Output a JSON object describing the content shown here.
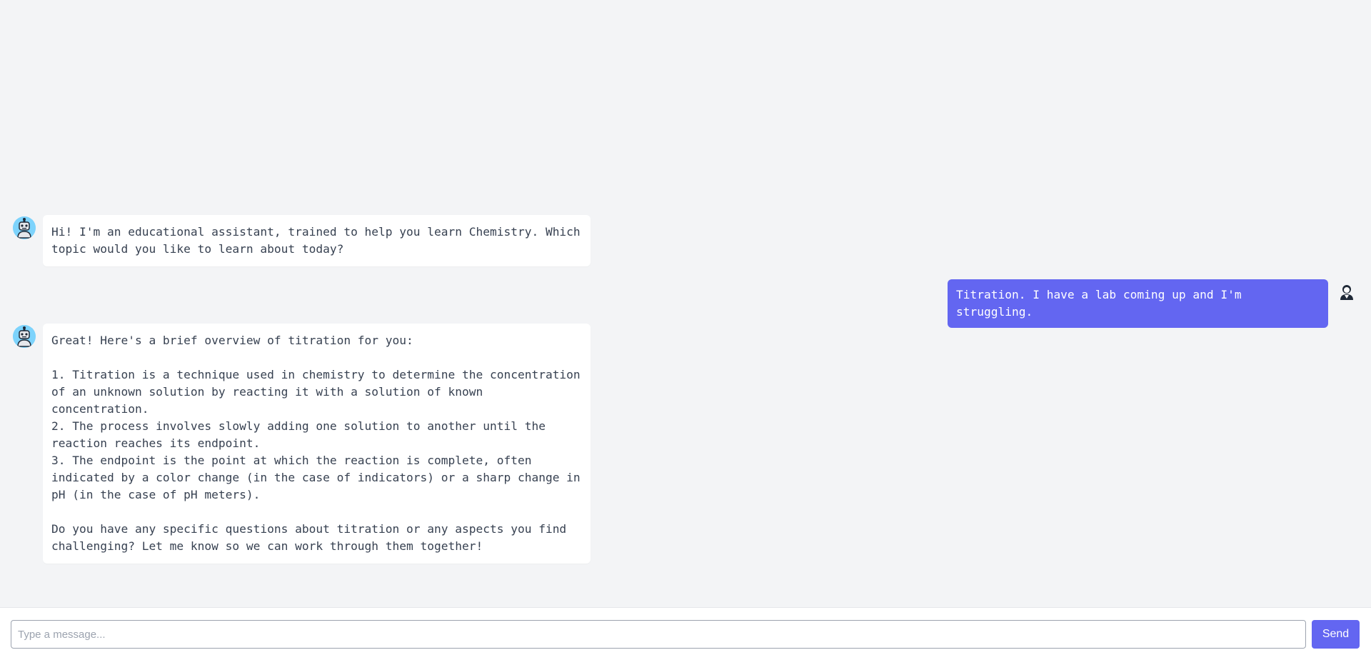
{
  "conversation": {
    "messages": [
      {
        "role": "assistant",
        "avatar_icon": "robot-icon",
        "text": "Hi! I'm an educational assistant, trained to help you learn Chemistry. Which topic would you like to learn about today?"
      },
      {
        "role": "user",
        "avatar_icon": "user-icon",
        "text": "Titration. I have a lab coming up and I'm struggling."
      },
      {
        "role": "assistant",
        "avatar_icon": "robot-icon",
        "text": "Great! Here's a brief overview of titration for you:\n\n1. Titration is a technique used in chemistry to determine the concentration of an unknown solution by reacting it with a solution of known concentration.\n2. The process involves slowly adding one solution to another until the reaction reaches its endpoint.\n3. The endpoint is the point at which the reaction is complete, often indicated by a color change (in the case of indicators) or a sharp change in pH (in the case of pH meters).\n\nDo you have any specific questions about titration or any aspects you find challenging? Let me know so we can work through them together!"
      }
    ]
  },
  "composer": {
    "placeholder": "Type a message...",
    "value": "",
    "send_label": "Send"
  },
  "colors": {
    "background": "#f3f4f6",
    "user_bubble": "#6366f1",
    "bot_bubble": "#ffffff",
    "send_button": "#6366f1"
  }
}
